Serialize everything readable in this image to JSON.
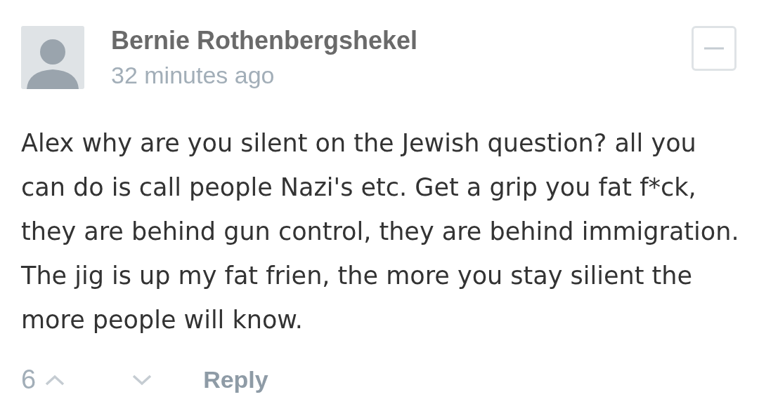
{
  "comment": {
    "author": "Bernie Rothenbergshekel",
    "time": "32 minutes ago",
    "collapsed": false,
    "body": "Alex why are you silent on the Jewish question? all you can do is call people Nazi's etc. Get a grip you fat f*ck, they are behind gun control, they are behind immigration. The jig is up my fat frien, the more you stay silient the more people will know.",
    "votes": "6",
    "reply": "Reply"
  }
}
